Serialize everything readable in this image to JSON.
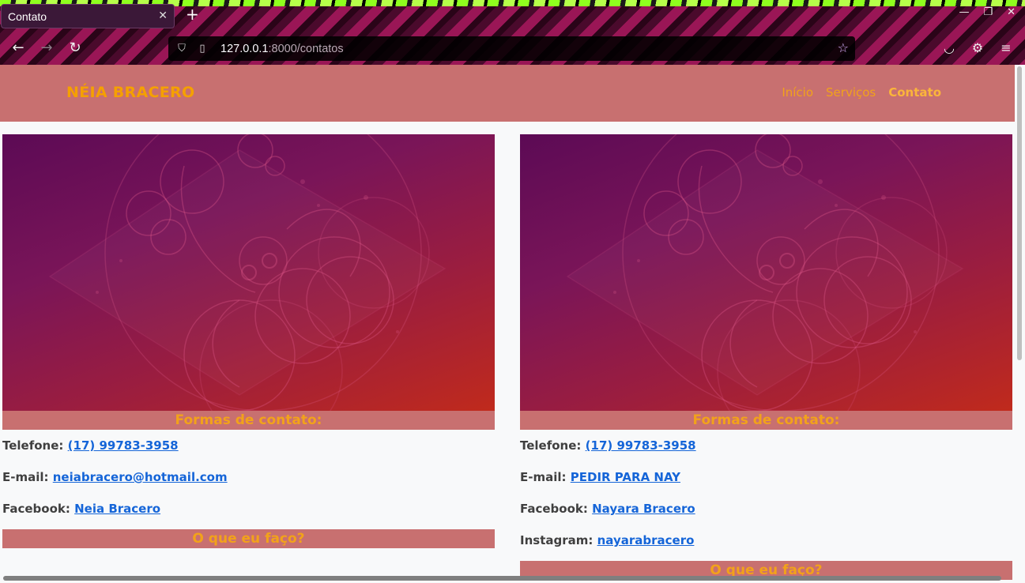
{
  "browser": {
    "tab_title": "Contato",
    "url_host": "127.0.0.1",
    "url_rest": ":8000/contatos"
  },
  "site": {
    "brand": "NÉIA BRACERO",
    "menu": [
      {
        "label": "Início"
      },
      {
        "label": "Serviços"
      },
      {
        "label": "Contato"
      }
    ]
  },
  "cards": [
    {
      "heading": "Formas de contato:",
      "rows": [
        {
          "label": "Telefone:",
          "value": "(17) 99783-3958"
        },
        {
          "label": "E-mail:",
          "value": "neiabracero@hotmail.com"
        },
        {
          "label": "Facebook:",
          "value": "Neia Bracero"
        }
      ],
      "second_heading": "O que eu faço?"
    },
    {
      "heading": "Formas de contato:",
      "rows": [
        {
          "label": "Telefone:",
          "value": "(17) 99783-3958"
        },
        {
          "label": "E-mail:",
          "value": "PEDIR PARA NAY"
        },
        {
          "label": "Facebook:",
          "value": "Nayara Bracero"
        },
        {
          "label": "Instagram:",
          "value": "nayarabracero"
        }
      ],
      "second_heading": "O que eu faço?"
    }
  ],
  "colors": {
    "navbar": "#c87070",
    "accent": "#f2a21a",
    "link": "#1565d8"
  }
}
